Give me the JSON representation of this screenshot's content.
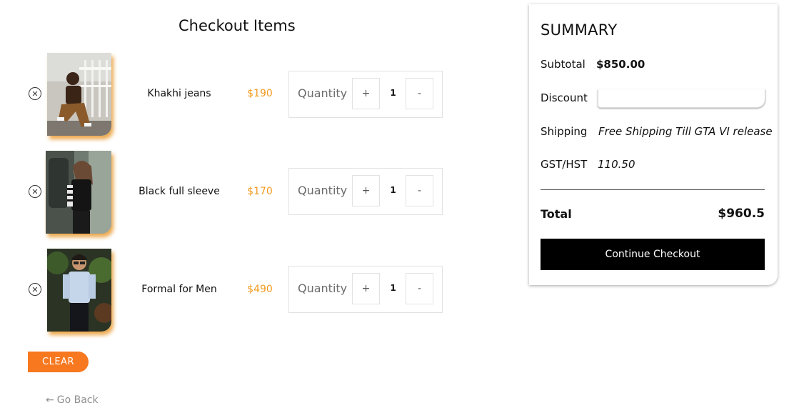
{
  "checkout": {
    "title": "Checkout Items",
    "quantity_label": "Quantity",
    "plus_label": "+",
    "minus_label": "-",
    "remove_icon": "close-circle-icon",
    "items": [
      {
        "name": "Khakhi jeans",
        "price": "$190",
        "quantity": "1",
        "image": "woman sitting in khaki overalls"
      },
      {
        "name": "Black full sleeve",
        "price": "$170",
        "quantity": "1",
        "image": "woman in black striped sleeve top"
      },
      {
        "name": "Formal for Men",
        "price": "$490",
        "quantity": "1",
        "image": "man in light blue formal shirt"
      }
    ],
    "clear_label": "CLEAR",
    "go_back_icon": "arrow-left-icon",
    "go_back_label": "Go Back"
  },
  "summary": {
    "title": "SUMMARY",
    "subtotal_label": "Subtotal",
    "subtotal_value": "$850.00",
    "discount_label": "Discount",
    "discount_value": "",
    "shipping_label": "Shipping",
    "shipping_value": "Free Shipping Till GTA VI release",
    "tax_label": "GST/HST",
    "tax_value": "110.50",
    "total_label": "Total",
    "total_value": "$960.5",
    "continue_label": "Continue Checkout"
  },
  "colors": {
    "accent_orange": "#f7781f",
    "price_orange": "#f39a1e",
    "button_black": "#000000",
    "muted_text": "#8e8e8e"
  }
}
